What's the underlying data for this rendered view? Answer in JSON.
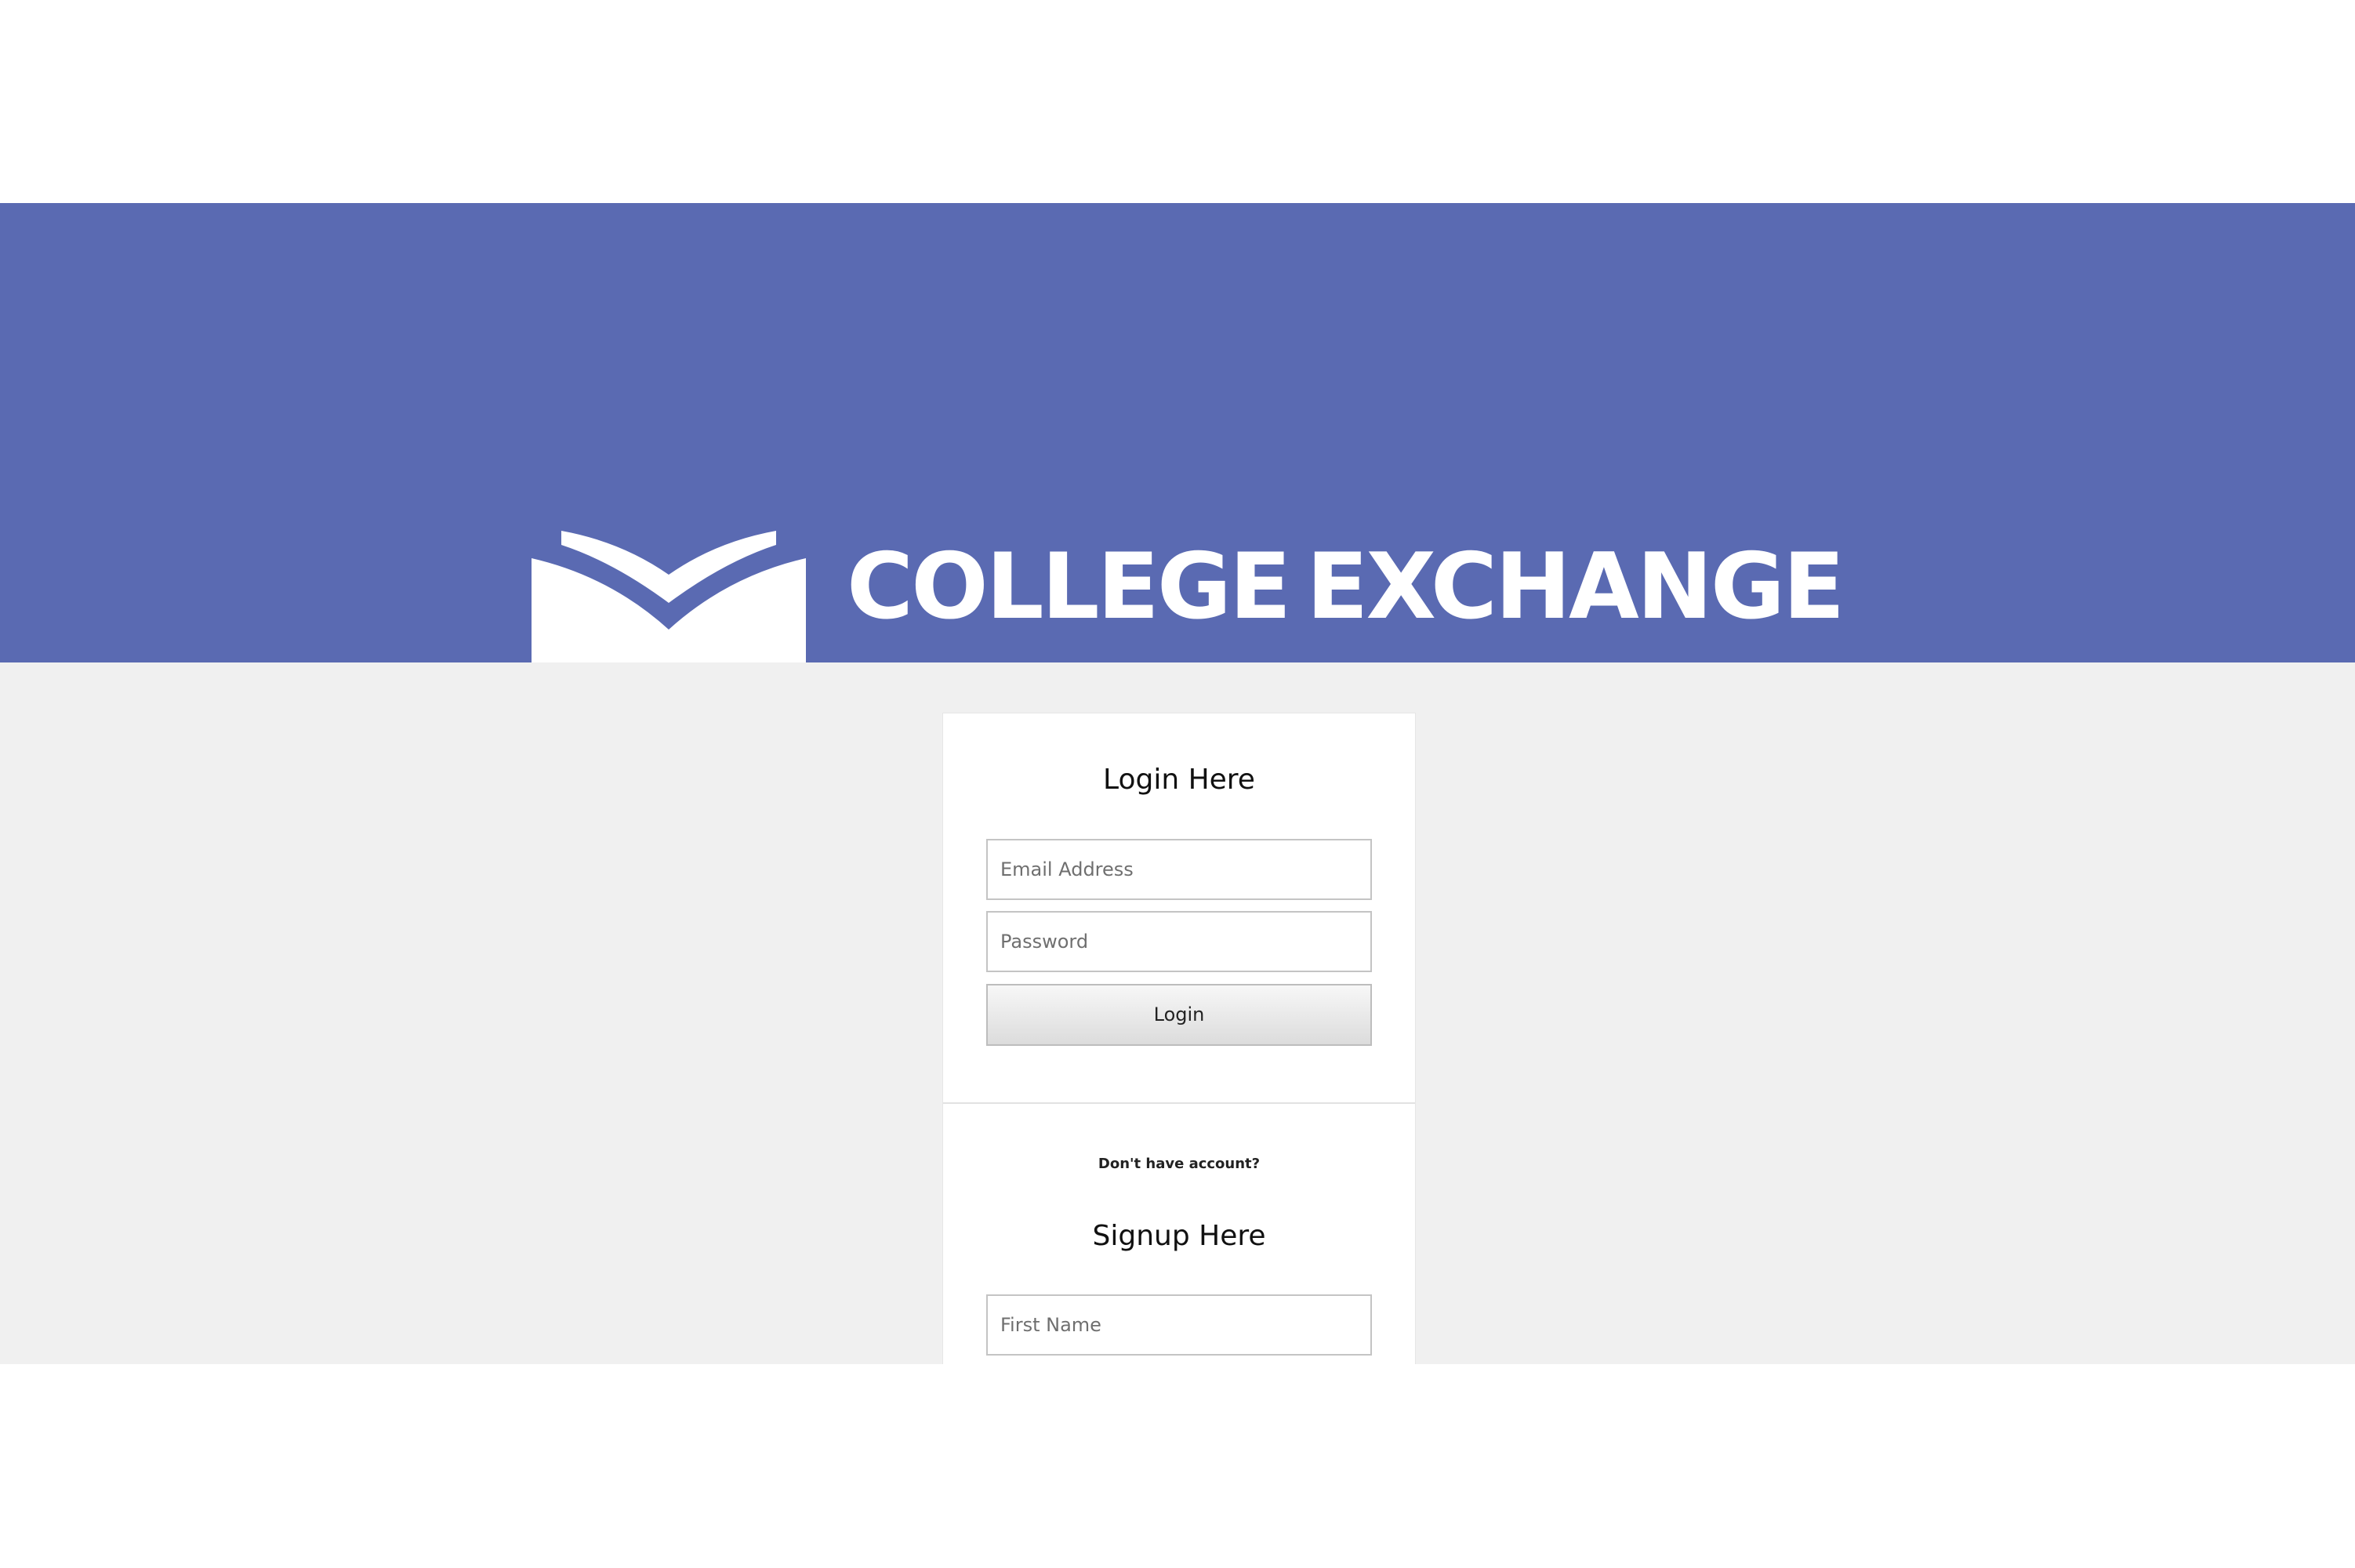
{
  "brand": {
    "logo_icon": "open-book-icon",
    "name_part1": "COLLEGE",
    "name_part2": "EXCHANGE",
    "color": "#5a6ab2"
  },
  "login": {
    "heading": "Login Here",
    "email_placeholder": "Email Address",
    "password_placeholder": "Password",
    "button_label": "Login"
  },
  "signup": {
    "prompt": "Don't have account?",
    "heading": "Signup Here",
    "first_name_placeholder": "First Name"
  },
  "colors": {
    "banner": "#5a6ab2",
    "background": "#f0f0f0",
    "card": "#ffffff"
  }
}
